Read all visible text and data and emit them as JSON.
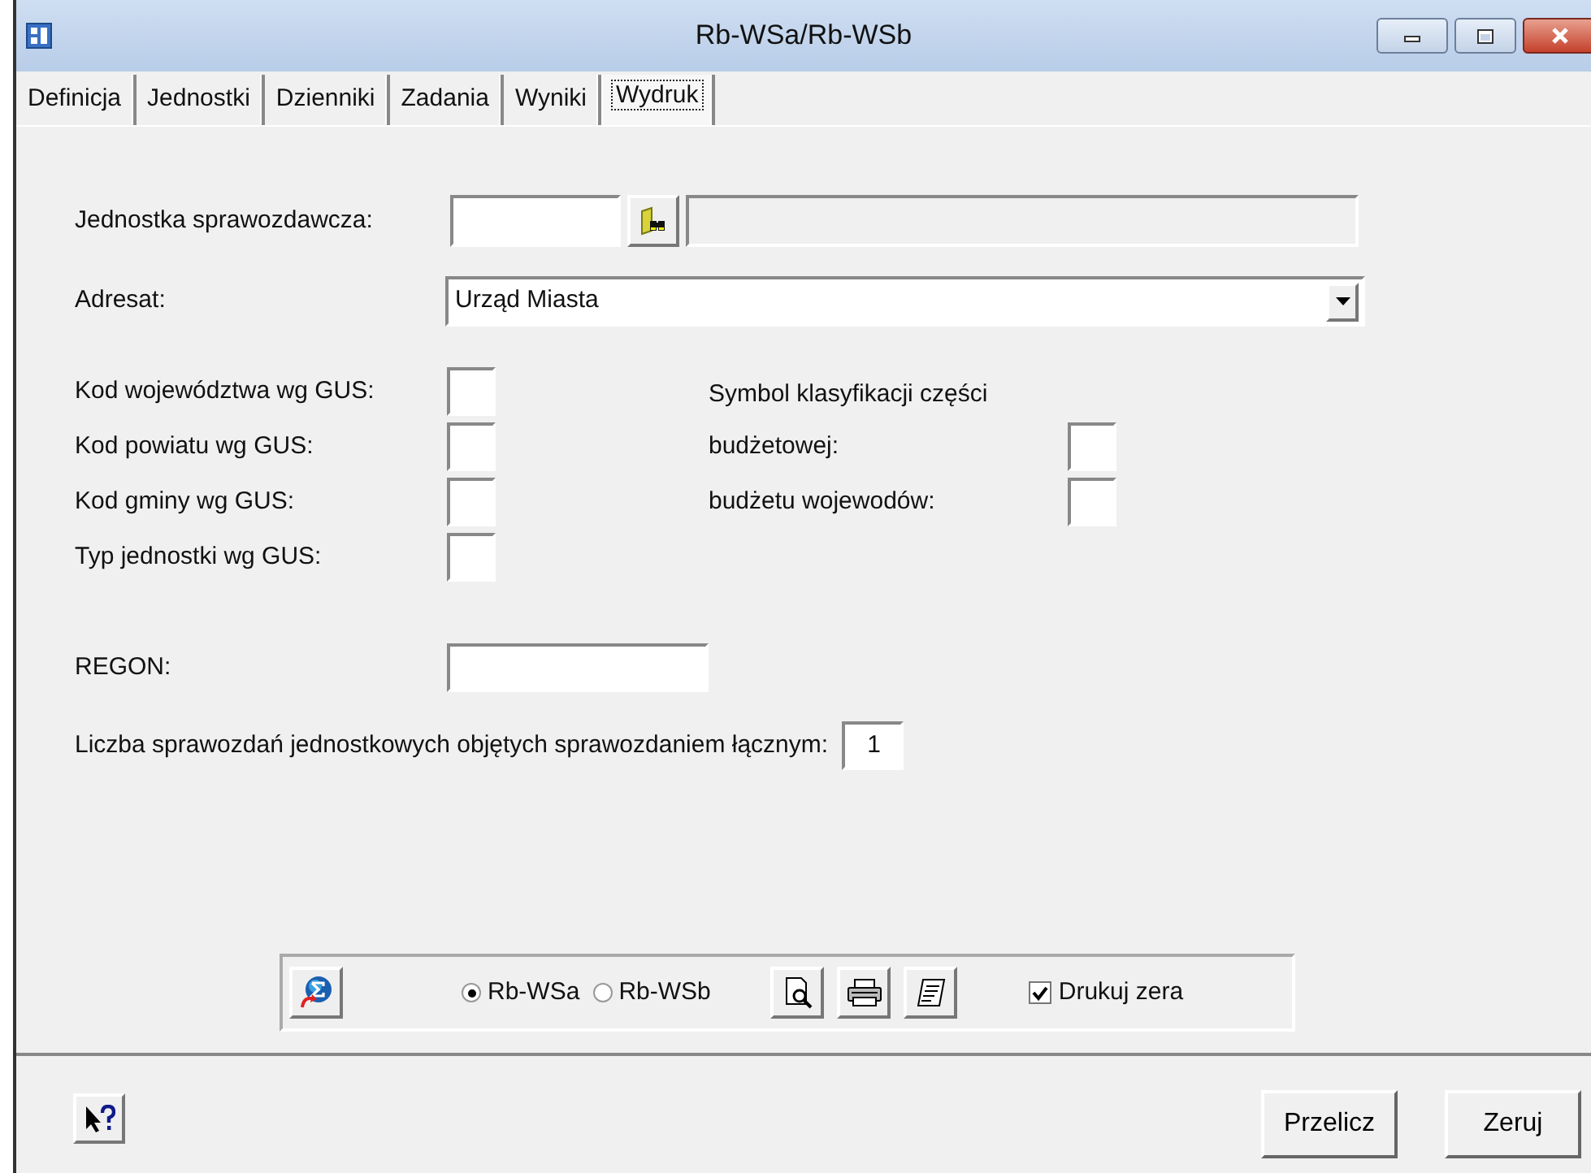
{
  "window": {
    "title": "Rb-WSa/Rb-WSb"
  },
  "tabs": [
    {
      "label": "Definicja",
      "selected": false
    },
    {
      "label": "Jednostki",
      "selected": false
    },
    {
      "label": "Dzienniki",
      "selected": false
    },
    {
      "label": "Zadania",
      "selected": false
    },
    {
      "label": "Wyniki",
      "selected": false
    },
    {
      "label": "Wydruk",
      "selected": true
    }
  ],
  "form": {
    "reporting_unit": {
      "label": "Jednostka sprawozdawcza:"
    },
    "addressee": {
      "label": "Adresat:",
      "value": "Urząd Miasta"
    },
    "gus_codes": [
      "Kod województwa wg GUS:",
      "Kod powiatu wg GUS:",
      "Kod gminy wg GUS:",
      "Typ jednostki wg GUS:"
    ],
    "classification": {
      "heading": "Symbol klasyfikacji części",
      "items": [
        "budżetowej:",
        "budżetu wojewodów:"
      ]
    },
    "regon": {
      "label": "REGON:"
    },
    "unit_count": {
      "label": "Liczba sprawozdań jednostkowych objętych sprawozdaniem łącznym:",
      "value": "1"
    }
  },
  "print_toolbar": {
    "variants": [
      {
        "label": "Rb-WSa",
        "selected": true
      },
      {
        "label": "Rb-WSb",
        "selected": false
      }
    ],
    "print_zeros": {
      "label": "Drukuj zera",
      "checked": true
    }
  },
  "buttons": [
    "Przelicz",
    "Zeruj"
  ]
}
